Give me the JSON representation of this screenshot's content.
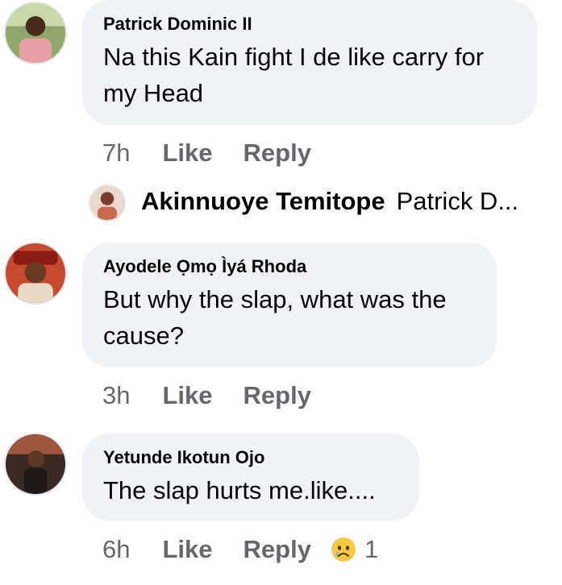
{
  "comments": [
    {
      "author": "Patrick Dominic II",
      "text": "Na this Kain fight I de like carry for my Head",
      "time": "7h",
      "like": "Like",
      "reply": "Reply"
    },
    {
      "author": "Ayodele Ọmọ Ìyá Rhoda",
      "text": "But why the slap, what was the cause?",
      "time": "3h",
      "like": "Like",
      "reply": "Reply"
    },
    {
      "author": "Yetunde Ikotun Ojo",
      "text": "The slap hurts me.like....",
      "time": "6h",
      "like": "Like",
      "reply": "Reply",
      "reaction_icon": "sad-crying-emoji-icon",
      "reaction_count": "1"
    }
  ],
  "reply_preview": {
    "author": "Akinnuoye Temitope",
    "snippet": "Patrick D..."
  },
  "colors": {
    "bubble": "#f0f2f5",
    "meta": "#65676b",
    "text": "#050505"
  }
}
